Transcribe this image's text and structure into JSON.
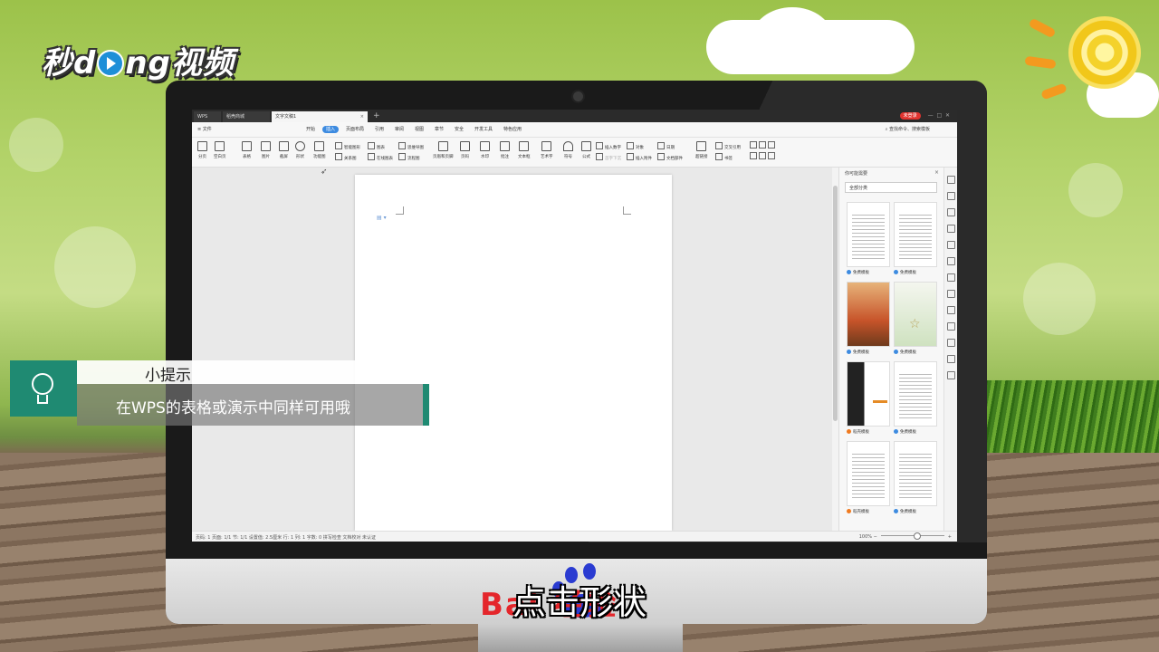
{
  "watermark": {
    "logo_text_a": "秒",
    "logo_text_b": "d",
    "logo_text_c": "ng视频"
  },
  "tabs": [
    {
      "label": "WPS"
    },
    {
      "label": "稻壳商城"
    },
    {
      "label": "文字文稿1"
    }
  ],
  "window": {
    "login_badge": "未登录"
  },
  "menu": {
    "file": "≡ 文件",
    "items": [
      "开始",
      "插入",
      "页面布局",
      "引用",
      "审阅",
      "视图",
      "章节",
      "安全",
      "开发工具",
      "特色应用"
    ],
    "active_index": 1,
    "search": "查找命令、搜索模板"
  },
  "ribbon": {
    "big": [
      "分页",
      "空白页",
      "表格",
      "图片",
      "截屏",
      "形状",
      "功能图",
      "页眉和页脚",
      "页码",
      "水印",
      "批注",
      "文本框",
      "艺术字",
      "符号",
      "公式",
      "超链接"
    ],
    "small": [
      "智能图形",
      "关系图",
      "图表",
      "在线图表",
      "思维导图",
      "流程图",
      "插入数字",
      "首字下沉",
      "对象",
      "插入附件",
      "日期",
      "文档部件",
      "交叉引用",
      "书签"
    ]
  },
  "panel": {
    "title": "你可能需要",
    "select": "全部分类",
    "templates": [
      {
        "label": "免费模板"
      },
      {
        "label": "免费模板"
      },
      {
        "label": "免费模板"
      },
      {
        "label": "免费模板"
      },
      {
        "label": "稻壳模板"
      },
      {
        "label": "免费模板"
      },
      {
        "label": "稻壳模板"
      },
      {
        "label": "免费模板"
      }
    ]
  },
  "status": {
    "left": "页码: 1   页面: 1/1   节: 1/1   设置值: 2.5厘米   行: 1   列: 1   字数: 0   拼写检查   文档校对   未认证",
    "zoom": "100%"
  },
  "tip": {
    "title": "小提示",
    "body": "在WPS的表格或演示中同样可用哦"
  },
  "baidu": {
    "text": "Bai  经验"
  },
  "subtitle": "点击形状",
  "colors": {
    "accent": "#1f8a72",
    "wps_blue": "#3d8be0",
    "badge_red": "#e0332f"
  }
}
